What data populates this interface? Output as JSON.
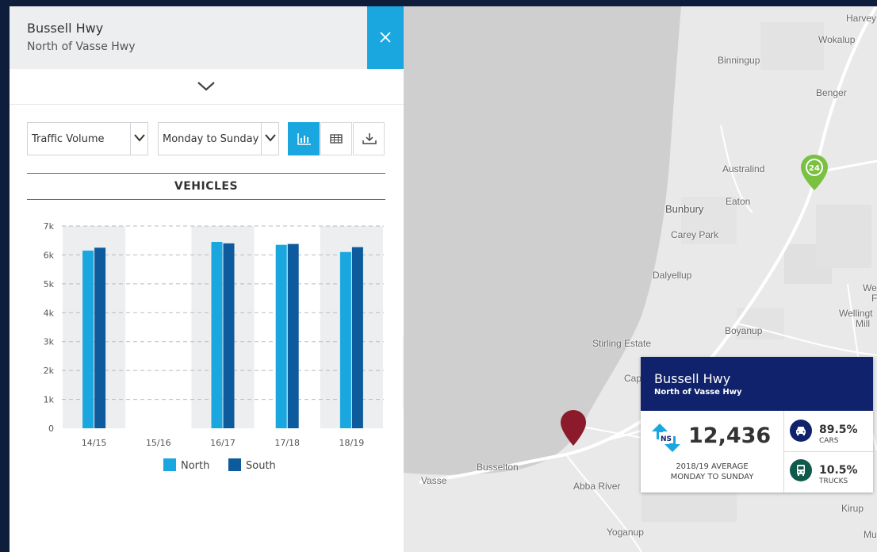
{
  "panel": {
    "title": "Bussell Hwy",
    "subtitle": "North of Vasse Hwy"
  },
  "controls": {
    "metric_select": "Traffic Volume",
    "days_select": "Monday to Sunday"
  },
  "chart_data": {
    "type": "bar",
    "title": "VEHICLES",
    "categories": [
      "14/15",
      "15/16",
      "16/17",
      "17/18",
      "18/19"
    ],
    "series": [
      {
        "name": "North",
        "color": "#1aa7e0",
        "values": [
          6150,
          null,
          6450,
          6350,
          6100
        ]
      },
      {
        "name": "South",
        "color": "#0d5b9c",
        "values": [
          6250,
          null,
          6400,
          6380,
          6270
        ]
      }
    ],
    "yticks": [
      "0",
      "1k",
      "2k",
      "3k",
      "4k",
      "5k",
      "6k",
      "7k"
    ],
    "ylim": [
      0,
      7000
    ],
    "grid": true,
    "legend": "bottom"
  },
  "map": {
    "places": [
      "Harvey",
      "Wokalup",
      "Binningup",
      "Benger",
      "Australind",
      "Eaton",
      "Bunbury",
      "Carey Park",
      "Dalyellup",
      "Boyanup",
      "Stirling Estate",
      "Cap",
      "Busselton",
      "Vasse",
      "Abba River",
      "Yoganup",
      "Kirup",
      "Mu",
      "We",
      "F",
      "Wellingt",
      "Mill"
    ],
    "marker_badge": "24"
  },
  "info_card": {
    "title": "Bussell Hwy",
    "subtitle": "North of Vasse Hwy",
    "direction_icon_text": "NS",
    "count": "12,436",
    "avg_line1": "2018/19 AVERAGE",
    "avg_line2": "MONDAY TO SUNDAY",
    "cars_pct": "89.5%",
    "cars_label": "CARS",
    "trucks_pct": "10.5%",
    "trucks_label": "TRUCKS"
  },
  "icons": {
    "close": "close-icon",
    "collapse": "chevron-down-icon",
    "chart_view": "bar-chart-icon",
    "table_view": "table-icon",
    "download": "download-icon",
    "expand": "chevron-right-icon"
  }
}
